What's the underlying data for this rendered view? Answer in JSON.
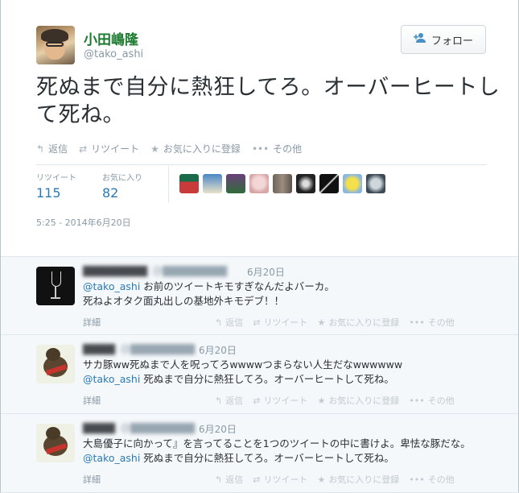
{
  "tweet": {
    "display_name": "小田嶋隆",
    "screen_name": "@tako_ashi",
    "text": "死ぬまで自分に熱狂してろ。オーバーヒートして死ね。",
    "follow_label": "フォロー",
    "actions": [
      {
        "icon": "reply-icon",
        "label": "返信"
      },
      {
        "icon": "retweet-icon",
        "label": "リツイート"
      },
      {
        "icon": "star-icon",
        "label": "お気に入りに登録"
      },
      {
        "icon": "more-icon",
        "label": "その他"
      }
    ],
    "stats": {
      "retweet_label": "リツイート",
      "retweet_count": "115",
      "favorite_label": "お気に入り",
      "favorite_count": "82"
    },
    "timestamp": "5:25 - 2014年6月20日"
  },
  "replies": [
    {
      "name": "▇▇▇▇▇▇▇▇",
      "handle": "@▇▇▇▇▇▇▇▇",
      "date": "6月20日",
      "mention": "@tako_ashi",
      "line1": " お前のツイートキモすぎなんだよバーカ。",
      "line2": "死ねよオタク面丸出しの基地外キモデブ！！",
      "detail": "詳細",
      "avatar": "wine-glass"
    },
    {
      "name": "▇▇▇▇",
      "handle": "@▇▇▇▇▇▇▇▇",
      "date": "6月20日",
      "line1": "サカ豚ww死ぬまで人を呪ってろwwwwつまらない人生だなwwwwww",
      "mention": "@tako_ashi",
      "line2": " 死ぬまで自分に熱狂してろ。オーバーヒートして死ね。",
      "detail": "詳細",
      "avatar": "horse-mascot"
    },
    {
      "name": "▇▇▇▇",
      "handle": "@▇▇▇▇▇▇▇▇",
      "date": "6月20日",
      "line1": "大島優子に向かって』を言ってることを1つのツイートの中に書けよ。卑怯な豚だな。",
      "mention": "@tako_ashi",
      "line2": " 死ぬまで自分に熱狂してろ。オーバーヒートして死ね。",
      "detail": "詳細",
      "avatar": "horse-mascot"
    }
  ],
  "reply_actions": [
    {
      "icon": "reply-icon",
      "label": "返信"
    },
    {
      "icon": "retweet-icon",
      "label": "リツイート"
    },
    {
      "icon": "star-icon",
      "label": "お気に入りに登録"
    },
    {
      "icon": "more-icon",
      "label": "その他"
    }
  ]
}
